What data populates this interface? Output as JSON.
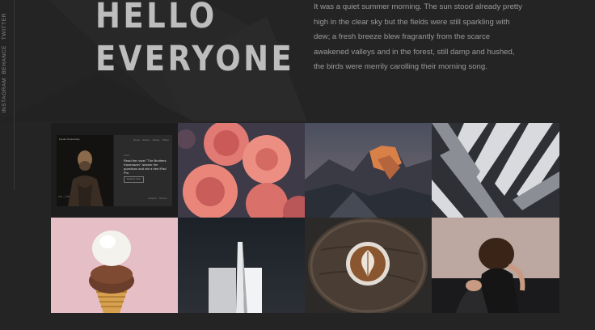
{
  "sidebar": {
    "links": [
      "Twitter",
      "Behance",
      "Instagram"
    ]
  },
  "hero": {
    "title_line1": "HELLO",
    "title_line2": "EVERYONE",
    "paragraph": "It was a quiet summer morning. The sun stood already pretty high in the clear sky but the fields were still sparkling with dew; a fresh breeze blew fragrantly from the scarce awakened valleys and in the forest, still damp and hushed, the birds were merrily carolling their morning song."
  },
  "gallery": {
    "items": [
      {
        "icon": "website-mockup-image"
      },
      {
        "icon": "pink-roses-image"
      },
      {
        "icon": "mountain-sunset-image"
      },
      {
        "icon": "architecture-stripes-image"
      },
      {
        "icon": "ice-cream-cone-image"
      },
      {
        "icon": "white-tower-image"
      },
      {
        "icon": "latte-art-image"
      },
      {
        "icon": "person-sitting-image"
      }
    ],
    "mockup": {
      "brand": "Fyodor Dostoevsky",
      "nav": [
        "Home",
        "Stories",
        "Books",
        "Photo"
      ],
      "meta": "Fiction",
      "heading": "Read the novel \"The Brothers Karamazov\" answer the questions and win a free iPad Pro",
      "button": "Read the novel",
      "caption": "1821 — 1881",
      "footer": [
        "Instagram",
        "Behance"
      ]
    }
  },
  "colors": {
    "background": "#242424",
    "title": "#bdbdbd",
    "body_text": "#9a9a9a"
  }
}
